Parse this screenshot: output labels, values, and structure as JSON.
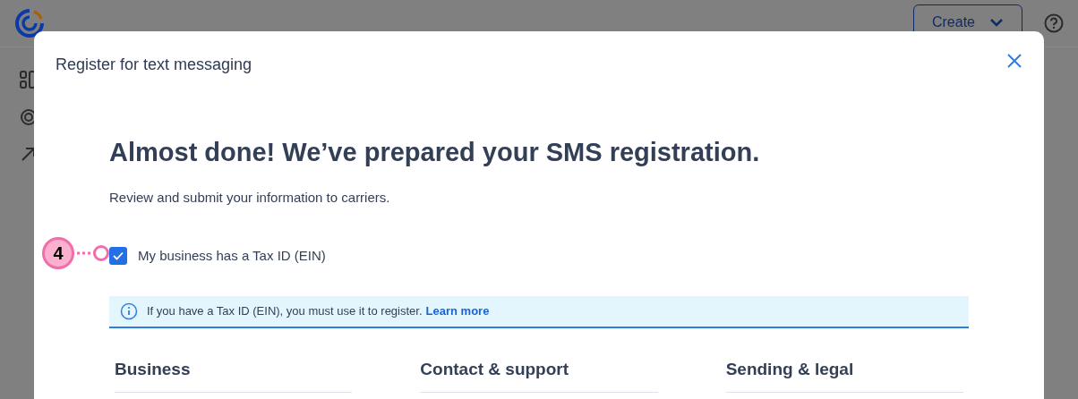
{
  "app_header": {
    "create_button": "Create"
  },
  "dialog": {
    "title": "Register for text messaging",
    "heading": "Almost done! We’ve prepared your SMS registration.",
    "subtitle": "Review and submit your information to carriers.",
    "tax_checkbox": {
      "label": "My business has a Tax ID (EIN)",
      "checked": true
    },
    "info_banner": {
      "text": "If you have a Tax ID (EIN), you must use it to register.",
      "link": "Learn more"
    },
    "sections": [
      "Business",
      "Contact & support",
      "Sending & legal"
    ]
  },
  "callout": {
    "number": "4"
  }
}
